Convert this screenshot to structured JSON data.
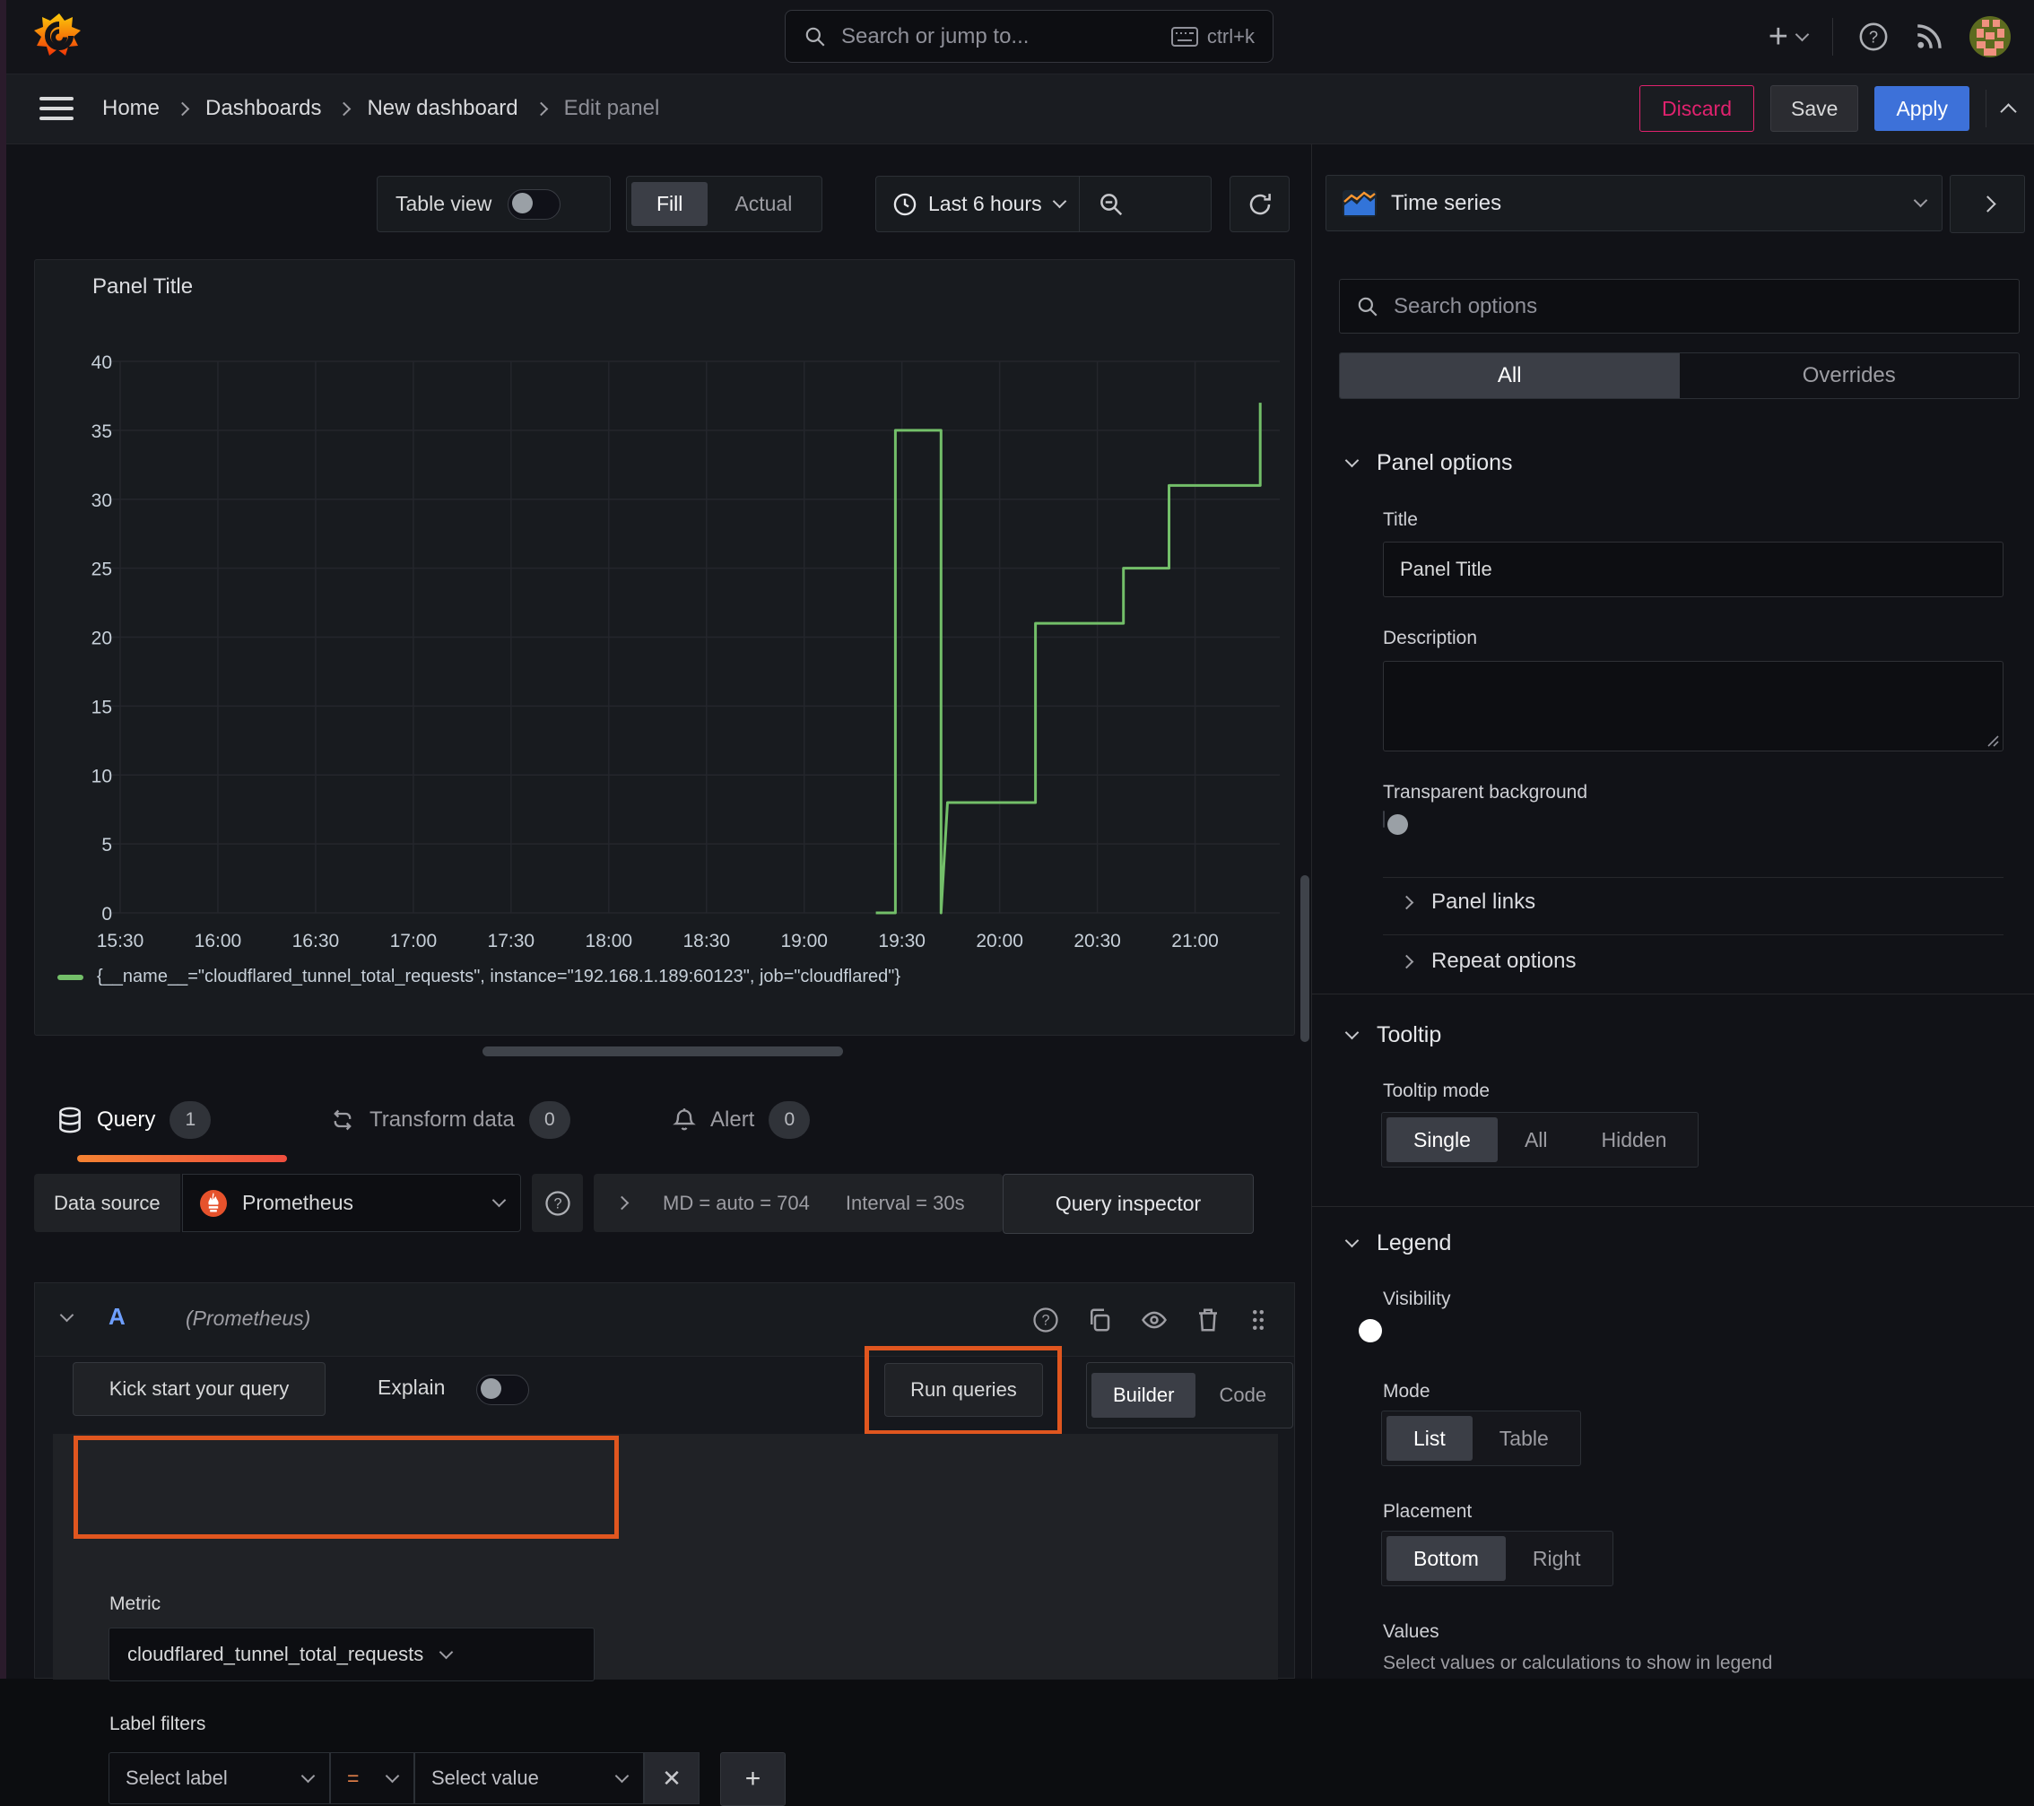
{
  "topnav": {
    "search_placeholder": "Search or jump to...",
    "shortcut": "ctrl+k",
    "icons": [
      "grafana-logo",
      "search-icon",
      "keyboard-icon",
      "plus-icon",
      "chevron-down-icon",
      "help-icon",
      "rss-icon",
      "avatar"
    ]
  },
  "breadcrumb": {
    "items": [
      "Home",
      "Dashboards",
      "New dashboard",
      "Edit panel"
    ]
  },
  "actions": {
    "discard": "Discard",
    "save": "Save",
    "apply": "Apply"
  },
  "toolbar": {
    "table_view_label": "Table view",
    "fill": "Fill",
    "actual": "Actual",
    "time_range": "Last 6 hours",
    "icons": [
      "clock-icon",
      "chevron-down-icon",
      "zoom-out-icon",
      "refresh-icon"
    ]
  },
  "viz_picker": {
    "type": "Time series",
    "icons": [
      "timeseries-icon",
      "chevron-down-icon",
      "chevron-right-icon"
    ]
  },
  "options_pane": {
    "search_placeholder": "Search options",
    "tab_all": "All",
    "tab_overrides": "Overrides",
    "panel_options": {
      "header": "Panel options",
      "title_label": "Title",
      "title_value": "Panel Title",
      "description_label": "Description",
      "description_value": "",
      "transparent_label": "Transparent background"
    },
    "panel_links": "Panel links",
    "repeat_options": "Repeat options",
    "tooltip": {
      "header": "Tooltip",
      "mode_label": "Tooltip mode",
      "modes": [
        "Single",
        "All",
        "Hidden"
      ],
      "active_mode": "Single"
    },
    "legend": {
      "header": "Legend",
      "visibility_label": "Visibility",
      "mode_label": "Mode",
      "modes": [
        "List",
        "Table"
      ],
      "active_mode": "List",
      "placement_label": "Placement",
      "placements": [
        "Bottom",
        "Right"
      ],
      "active_placement": "Bottom",
      "values_label": "Values",
      "values_hint": "Select values or calculations to show in legend"
    }
  },
  "panel": {
    "title": "Panel Title"
  },
  "chart_data": {
    "type": "line",
    "title": "Panel Title",
    "xlabel": "",
    "ylabel": "",
    "ylim": [
      0,
      40
    ],
    "y_ticks": [
      0,
      5,
      10,
      15,
      20,
      25,
      30,
      35,
      40
    ],
    "x_ticks": [
      "15:30",
      "16:00",
      "16:30",
      "17:00",
      "17:30",
      "18:00",
      "18:30",
      "19:00",
      "19:30",
      "20:00",
      "20:30",
      "21:00"
    ],
    "x_tick_minutes": [
      0,
      30,
      60,
      90,
      120,
      150,
      180,
      210,
      240,
      270,
      300,
      330
    ],
    "xlim_minutes": [
      -4,
      356
    ],
    "grid": true,
    "legend_position": "bottom",
    "series": [
      {
        "name": "{__name__=\"cloudflared_tunnel_total_requests\", instance=\"192.168.1.189:60123\", job=\"cloudflared\"}",
        "color": "#73BF69",
        "points_minutes_value": [
          [
            232,
            0
          ],
          [
            238,
            0
          ],
          [
            238,
            35
          ],
          [
            252,
            35
          ],
          [
            252,
            0
          ],
          [
            254,
            8
          ],
          [
            281,
            8
          ],
          [
            281,
            21
          ],
          [
            308,
            21
          ],
          [
            308,
            25
          ],
          [
            322,
            25
          ],
          [
            322,
            31
          ],
          [
            350,
            31
          ],
          [
            350,
            37
          ]
        ]
      }
    ]
  },
  "query_tabs": {
    "query": {
      "label": "Query",
      "badge": "1",
      "icon": "database-icon"
    },
    "transform": {
      "label": "Transform data",
      "badge": "0",
      "icon": "transform-icon"
    },
    "alert": {
      "label": "Alert",
      "badge": "0",
      "icon": "bell-icon"
    }
  },
  "datasource_row": {
    "label": "Data source",
    "value": "Prometheus",
    "options_summary_1": "MD = auto = 704",
    "options_summary_2": "Interval = 30s",
    "inspector": "Query inspector",
    "icons": [
      "prometheus-icon",
      "chevron-down-icon",
      "help-icon",
      "chevron-right-icon"
    ]
  },
  "query_editor": {
    "ref_id": "A",
    "datasource_hint": "(Prometheus)",
    "header_icons": [
      "help-icon",
      "copy-icon",
      "eye-icon",
      "trash-icon",
      "drag-handle-icon"
    ],
    "kickstart": "Kick start your query",
    "explain_label": "Explain",
    "run_queries": "Run queries",
    "builder": "Builder",
    "code": "Code",
    "metric_label": "Metric",
    "metric_value": "cloudflared_tunnel_total_requests",
    "label_filters_label": "Label filters",
    "select_label_placeholder": "Select label",
    "operator": "=",
    "select_value_placeholder": "Select value",
    "remove_icon": "close-icon",
    "add_icon": "plus-icon"
  },
  "colors": {
    "accent_blue": "#3d71d9",
    "series_green": "#73BF69",
    "discard_pink": "#e0226e",
    "annotation_orange": "#e0561f"
  }
}
